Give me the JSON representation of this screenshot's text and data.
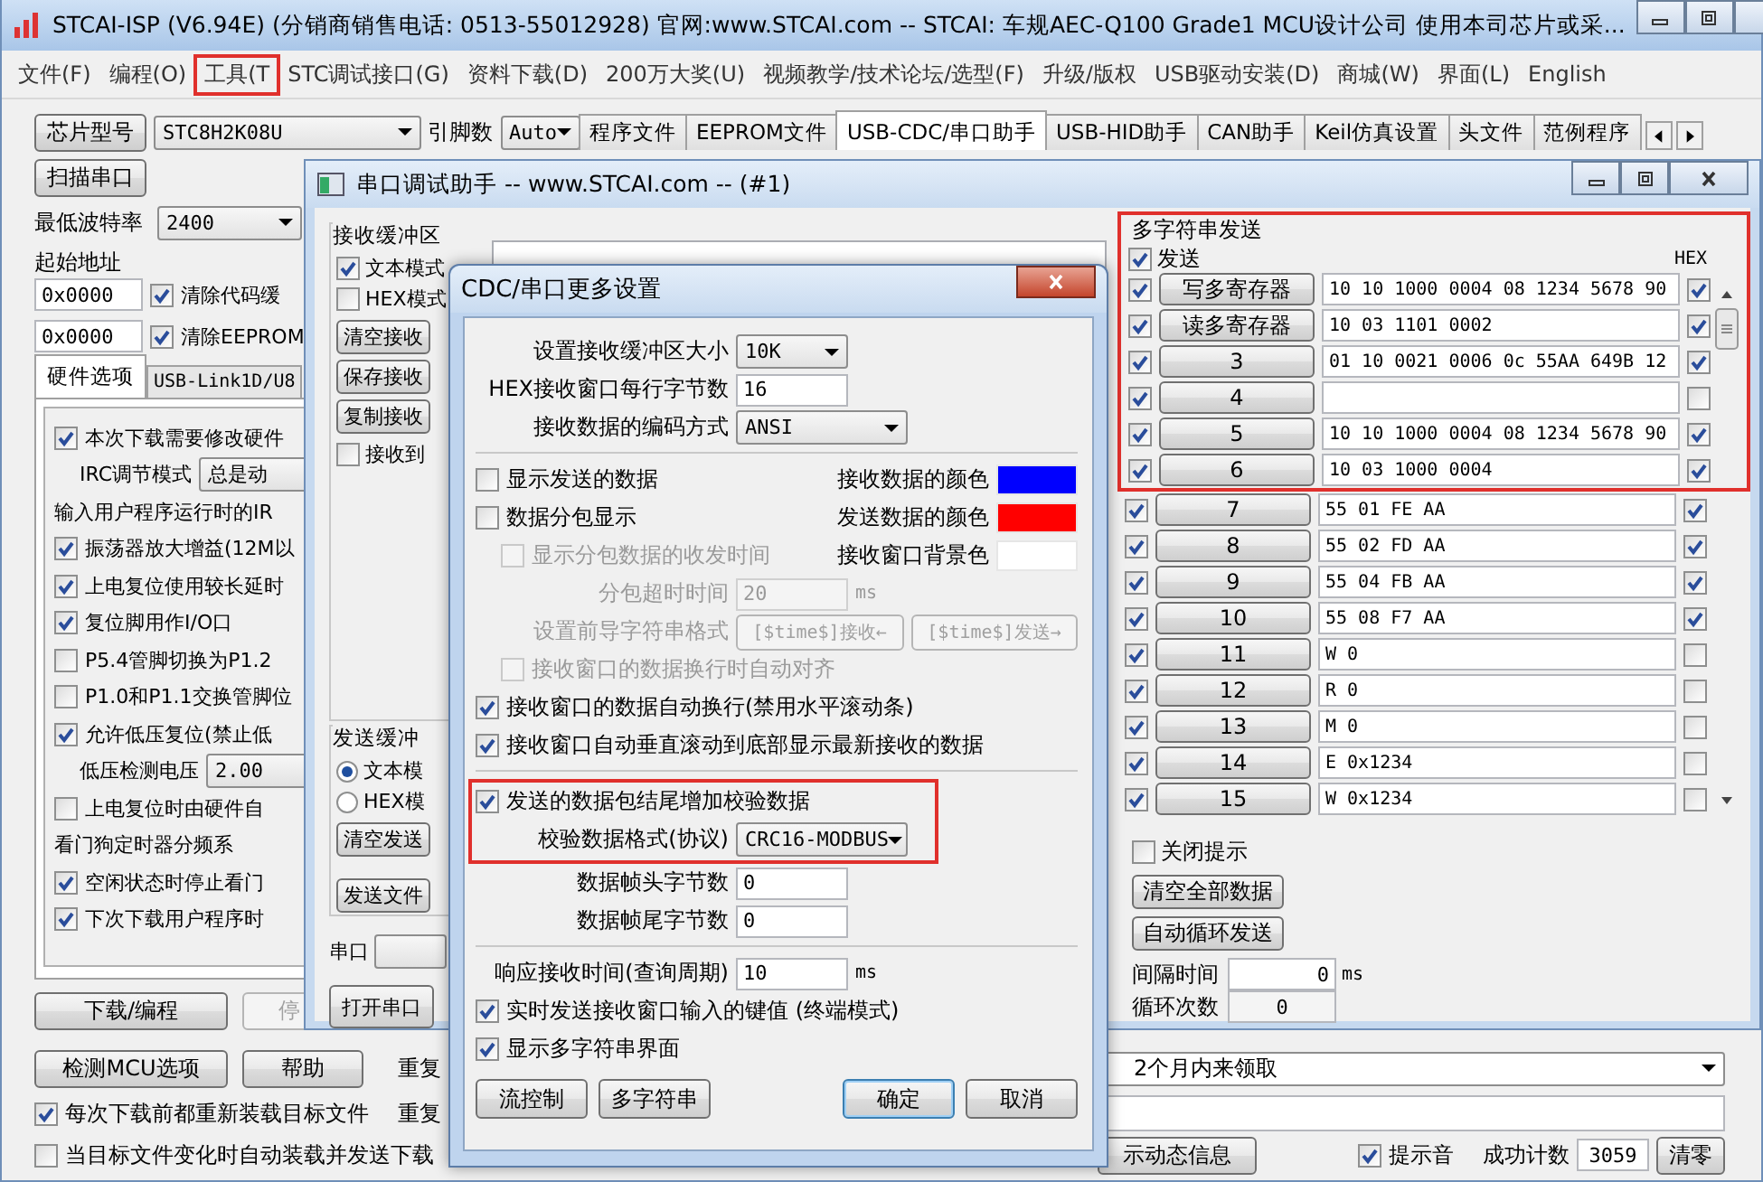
{
  "main_window": {
    "title": "STCAI-ISP (V6.94E) (分销商销售电话: 0513-55012928) 官网:www.STCAI.com  -- STCAI: 车规AEC-Q100 Grade1 MCU设计公司 使用本司芯片或采...",
    "menu": [
      {
        "label": "文件(F)",
        "highlighted": false
      },
      {
        "label": "编程(O)",
        "highlighted": false
      },
      {
        "label": "工具(T",
        "highlighted": true
      },
      {
        "label": "STC调试接口(G)",
        "highlighted": false
      },
      {
        "label": "资料下载(D)",
        "highlighted": false
      },
      {
        "label": "200万大奖(U)",
        "highlighted": false
      },
      {
        "label": "视频教学/技术论坛/选型(F)",
        "highlighted": false
      },
      {
        "label": "升级/版权",
        "highlighted": false
      },
      {
        "label": "USB驱动安装(D)",
        "highlighted": false
      },
      {
        "label": "商城(W)",
        "highlighted": false
      },
      {
        "label": "界面(L)",
        "highlighted": false
      },
      {
        "label": "English",
        "highlighted": false
      }
    ],
    "chip_button": "芯片型号",
    "chip_select": "STC8H2K08U",
    "pins_label": "引脚数",
    "pins_select": "Auto",
    "scan_button": "扫描串口",
    "baud_label": "最低波特率",
    "baud_select": "2400",
    "start_address_label": "起始地址",
    "address_rows": [
      {
        "value": "0x0000",
        "checked": true,
        "label": "清除代码缓"
      },
      {
        "value": "0x0000",
        "checked": true,
        "label": "清除EEPROM"
      }
    ],
    "option_tabs": [
      {
        "label": "硬件选项",
        "selected": true
      },
      {
        "label": "USB-Link1D/U8",
        "selected": false
      }
    ],
    "hardware_options": [
      {
        "kind": "check",
        "label": "本次下载需要修改硬件",
        "checked": true
      },
      {
        "kind": "select",
        "label": "IRC调节模式",
        "value": "总是动"
      },
      {
        "kind": "label",
        "label": "输入用户程序运行时的IR"
      },
      {
        "kind": "check",
        "label": "振荡器放大增益(12M以",
        "checked": true
      },
      {
        "kind": "check",
        "label": "上电复位使用较长延时",
        "checked": true
      },
      {
        "kind": "check",
        "label": "复位脚用作I/O口",
        "checked": true
      },
      {
        "kind": "check",
        "label": "P5.4管脚切换为P1.2",
        "checked": false
      },
      {
        "kind": "check",
        "label": "P1.0和P1.1交换管脚位",
        "checked": false
      },
      {
        "kind": "check",
        "label": "允许低压复位(禁止低",
        "checked": true
      },
      {
        "kind": "select",
        "label": "低压检测电压",
        "value": "2.00"
      },
      {
        "kind": "check",
        "label": "上电复位时由硬件自",
        "checked": false
      },
      {
        "kind": "label",
        "label": "看门狗定时器分频系"
      },
      {
        "kind": "check",
        "label": "空闲状态时停止看门",
        "checked": true
      },
      {
        "kind": "check",
        "label": "下次下载用户程序时",
        "checked": true
      }
    ],
    "download_button": "下载/编程",
    "stop_button": {
      "label": "停",
      "disabled": true
    },
    "detect_button": "检测MCU选项",
    "help_button": "帮助",
    "repeat_labels": [
      "重复",
      "重复"
    ],
    "reload_options": [
      {
        "label": "每次下载前都重新装载目标文件",
        "checked": true
      },
      {
        "label": "当目标文件变化时自动装载并发送下载",
        "checked": false
      }
    ],
    "tool_tabs": [
      {
        "label": "程序文件",
        "selected": false
      },
      {
        "label": "EEPROM文件",
        "selected": false
      },
      {
        "label": "USB-CDC/串口助手",
        "selected": true
      },
      {
        "label": "USB-HID助手",
        "selected": false
      },
      {
        "label": "CAN助手",
        "selected": false
      },
      {
        "label": "Keil仿真设置",
        "selected": false
      },
      {
        "label": "头文件",
        "selected": false
      },
      {
        "label": "范例程序",
        "selected": false
      }
    ],
    "message_combo": "2个月内来领取",
    "dynamic_info_button": "示动态信息",
    "sound": {
      "label": "提示音",
      "checked": true
    },
    "success_label": "成功计数",
    "success_count": "3059",
    "reset_button": "清零"
  },
  "serial_window": {
    "title": "串口调试助手 -- www.STCAI.com -- (#1)",
    "receive_group": {
      "title": "接收缓冲区",
      "modes": [
        {
          "label": "文本模式",
          "checked": true
        },
        {
          "label": "HEX模式",
          "checked": false
        }
      ],
      "buttons": [
        "清空接收",
        "保存接收",
        "复制接收"
      ],
      "to_file": {
        "label": "接收到",
        "checked": false
      }
    },
    "send_group": {
      "title": "发送缓冲",
      "modes": [
        {
          "label": "文本模",
          "selected": true
        },
        {
          "label": "HEX模",
          "selected": false
        }
      ],
      "buttons": [
        "清空发送",
        "发送文件"
      ]
    },
    "port_label": "串口",
    "open_button": "打开串口",
    "multi_send": {
      "highlighted": true,
      "title": "多字符串发送",
      "send_all": {
        "label": "发送",
        "checked": true
      },
      "hex_label": "HEX",
      "highlighted_rows": [
        {
          "checked": true,
          "button": "写多寄存器",
          "value": "10 10 1000 0004 08 1234 5678 90",
          "hex": true
        },
        {
          "checked": true,
          "button": "读多寄存器",
          "value": "10 03 1101 0002",
          "hex": true
        },
        {
          "checked": true,
          "button": "3",
          "value": "01 10 0021 0006 0c 55AA 649B 12",
          "hex": true
        },
        {
          "checked": true,
          "button": "4",
          "hex": false
        },
        {
          "checked": true,
          "button": "5",
          "value": "10 10 1000 0004 08 1234 5678 90",
          "hex": true
        },
        {
          "checked": true,
          "button": "6",
          "value": "10 03 1000 0004",
          "hex": true
        }
      ],
      "rows": [
        {
          "checked": true,
          "button": "7",
          "value": "55 01 FE AA",
          "hex": true
        },
        {
          "checked": true,
          "button": "8",
          "value": "55 02 FD AA",
          "hex": true
        },
        {
          "checked": true,
          "button": "9",
          "value": "55 04 FB AA",
          "hex": true
        },
        {
          "checked": true,
          "button": "10",
          "value": "55 08 F7 AA",
          "hex": true
        },
        {
          "checked": true,
          "button": "11",
          "value": "W 0",
          "hex": false
        },
        {
          "checked": true,
          "button": "12",
          "value": "R 0",
          "hex": false
        },
        {
          "checked": true,
          "button": "13",
          "value": "M 0",
          "hex": false
        },
        {
          "checked": true,
          "button": "14",
          "value": "E 0x1234",
          "hex": false
        },
        {
          "checked": true,
          "button": "15",
          "value": "W 0x1234",
          "hex": false
        }
      ],
      "close_hint": {
        "label": "关闭提示",
        "checked": false
      },
      "clear_button": "清空全部数据",
      "loop_button": "自动循环发送",
      "interval_label": "间隔时间",
      "interval_value": "0",
      "interval_unit": "ms",
      "count_label": "循环次数",
      "count_value": "0"
    }
  },
  "dialog": {
    "title": "CDC/串口更多设置",
    "top_fields": [
      {
        "kind": "select",
        "label": "设置接收缓冲区大小",
        "value": "10K"
      },
      {
        "kind": "input",
        "label": "HEX接收窗口每行字节数",
        "value": "16"
      },
      {
        "kind": "select",
        "label": "接收数据的编码方式",
        "value": "ANSI"
      }
    ],
    "display_options": [
      {
        "label": "显示发送的数据",
        "checked": false,
        "disabled": false,
        "color_label": "接收数据的颜色",
        "color": "#0000ff"
      },
      {
        "label": "数据分包显示",
        "checked": false,
        "disabled": false,
        "color_label": "发送数据的颜色",
        "color": "#ff0000"
      },
      {
        "label": "显示分包数据的收发时间",
        "checked": false,
        "disabled": true,
        "color_label": "接收窗口背景色",
        "color": "#ffffff"
      }
    ],
    "packet_timeout": {
      "label": "分包超时时间",
      "value": "20",
      "unit": "ms",
      "disabled": true
    },
    "prefix_format": {
      "label": "设置前导字符串格式",
      "buttons": [
        "[$time$]接收←",
        "[$time$]发送→"
      ],
      "disabled": true
    },
    "wrap_options": [
      {
        "label": "接收窗口的数据换行时自动对齐",
        "checked": false,
        "disabled": true
      },
      {
        "label": "接收窗口的数据自动换行(禁用水平滚动条)",
        "checked": true,
        "disabled": false
      },
      {
        "label": "接收窗口自动垂直滚动到底部显示最新接收的数据",
        "checked": true,
        "disabled": false
      }
    ],
    "checksum": {
      "highlighted": true,
      "label": "发送的数据包结尾增加校验数据",
      "checked": true,
      "format_label": "校验数据格式(协议)",
      "format": "CRC16-MODBUS"
    },
    "frame_fields": [
      {
        "label": "数据帧头字节数",
        "value": "0"
      },
      {
        "label": "数据帧尾字节数",
        "value": "0"
      }
    ],
    "response_time": {
      "label": "响应接收时间(查询周期)",
      "value": "10",
      "unit": "ms"
    },
    "bottom_options": [
      {
        "label": "实时发送接收窗口输入的键值 (终端模式)",
        "checked": true
      },
      {
        "label": "显示多字符串界面",
        "checked": true
      }
    ],
    "buttons": [
      {
        "label": "流控制",
        "default": false
      },
      {
        "label": "多字符串",
        "default": false
      },
      {
        "label": "确定",
        "default": true
      },
      {
        "label": "取消",
        "default": false
      }
    ]
  }
}
